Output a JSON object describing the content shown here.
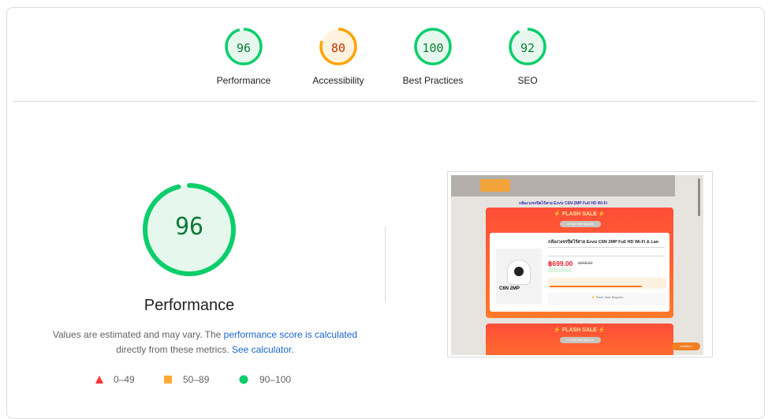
{
  "categories": [
    {
      "label": "Performance",
      "score": "96",
      "value": 96,
      "color": "#0cce6b",
      "fill": "#e6f8ee",
      "text_color": "#0c7a35"
    },
    {
      "label": "Accessibility",
      "score": "80",
      "value": 80,
      "color": "#ffa400",
      "fill": "#fff3e0",
      "text_color": "#c33300"
    },
    {
      "label": "Best Practices",
      "score": "100",
      "value": 100,
      "color": "#0cce6b",
      "fill": "#e6f8ee",
      "text_color": "#0c7a35"
    },
    {
      "label": "SEO",
      "score": "92",
      "value": 92,
      "color": "#0cce6b",
      "fill": "#e6f8ee",
      "text_color": "#0c7a35"
    }
  ],
  "main": {
    "score": "96",
    "value": 96,
    "title": "Performance",
    "desc_prefix": "Values are estimated and may vary. The ",
    "desc_link": "performance score is calculated",
    "desc_middle": "directly from these metrics. ",
    "calc_link": "See calculator."
  },
  "legend": [
    {
      "icon": "triangle-icon",
      "range": "0–49",
      "color": "#ff3333"
    },
    {
      "icon": "square-icon",
      "range": "50–89",
      "color": "#ffaa33"
    },
    {
      "icon": "circle-icon",
      "range": "90–100",
      "color": "#0cce6b"
    }
  ],
  "screenshot": {
    "heading": "กล้องวงจรปิดไร้สาย Ezviz C6N 2MP Full HD Wi-Fi",
    "flash_title": "⚡ FLASH SALE ⚡",
    "flash_pill": "● Flash Sale Bagnuts",
    "product_title": "กล้องวงจรปิดไร้สาย Ezviz C6N 2MP Full HD Wi-Fi & Lan",
    "price": "฿699.00",
    "old_price": "฿899.00",
    "cam_label": "C6N 2MP",
    "stock_fraction": 0.8,
    "bottom_text": "⚡ Flash Sale Bagnuts",
    "chat_text": "แชทกับเรา"
  }
}
